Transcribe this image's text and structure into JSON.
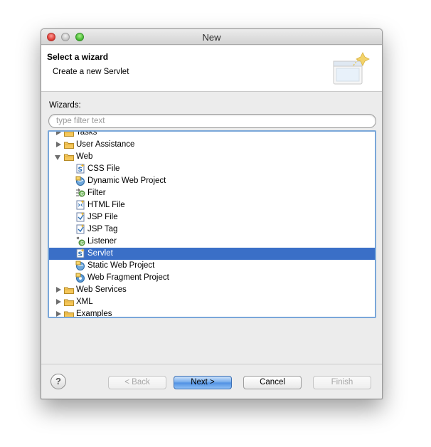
{
  "window": {
    "title": "New"
  },
  "header": {
    "title": "Select a wizard",
    "description": "Create a new Servlet"
  },
  "wizards_label": "Wizards:",
  "filter": {
    "placeholder": "type filter text",
    "value": ""
  },
  "tree": {
    "items": [
      {
        "label": "Tasks",
        "kind": "folder",
        "state": "closed",
        "level": 0
      },
      {
        "label": "User Assistance",
        "kind": "folder",
        "state": "closed",
        "level": 0
      },
      {
        "label": "Web",
        "kind": "folder",
        "state": "open",
        "level": 0
      },
      {
        "label": "CSS File",
        "kind": "item",
        "icon": "css-file-icon",
        "level": 1
      },
      {
        "label": "Dynamic Web Project",
        "kind": "item",
        "icon": "dynamic-web-project-icon",
        "level": 1
      },
      {
        "label": "Filter",
        "kind": "item",
        "icon": "filter-icon",
        "level": 1
      },
      {
        "label": "HTML File",
        "kind": "item",
        "icon": "html-file-icon",
        "level": 1
      },
      {
        "label": "JSP File",
        "kind": "item",
        "icon": "jsp-file-icon",
        "level": 1
      },
      {
        "label": "JSP Tag",
        "kind": "item",
        "icon": "jsp-tag-icon",
        "level": 1
      },
      {
        "label": "Listener",
        "kind": "item",
        "icon": "listener-icon",
        "level": 1
      },
      {
        "label": "Servlet",
        "kind": "item",
        "icon": "servlet-icon",
        "level": 1,
        "selected": true
      },
      {
        "label": "Static Web Project",
        "kind": "item",
        "icon": "static-web-project-icon",
        "level": 1
      },
      {
        "label": "Web Fragment Project",
        "kind": "item",
        "icon": "web-fragment-project-icon",
        "level": 1
      },
      {
        "label": "Web Services",
        "kind": "folder",
        "state": "closed",
        "level": 0
      },
      {
        "label": "XML",
        "kind": "folder",
        "state": "closed",
        "level": 0
      },
      {
        "label": "Examples",
        "kind": "folder",
        "state": "closed",
        "level": 0
      }
    ]
  },
  "buttons": {
    "help": "?",
    "back": "< Back",
    "next": "Next >",
    "cancel": "Cancel",
    "finish": "Finish"
  },
  "colors": {
    "selection": "#3a6fc7",
    "tree_border": "#7aa7d9"
  }
}
